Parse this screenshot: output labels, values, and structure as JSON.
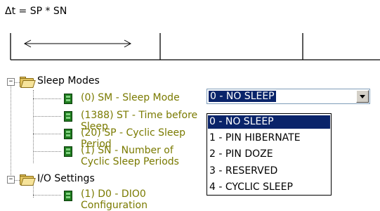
{
  "formula": "Δt = SP * SN",
  "tree": {
    "groups": [
      {
        "label": "Sleep Modes",
        "expander": "−",
        "params": [
          {
            "label": "(0) SM - Sleep Mode"
          },
          {
            "label": "(1388) ST - Time before Sleep"
          },
          {
            "label": "(20) SP - Cyclic Sleep Period"
          },
          {
            "label": "(1) SN - Number of Cyclic Sleep Periods"
          }
        ]
      },
      {
        "label": "I/O Settings",
        "expander": "−",
        "params": [
          {
            "label": "(1) D0 - DIO0 Configuration"
          }
        ]
      }
    ]
  },
  "combo": {
    "value": "0 - NO SLEEP",
    "options": [
      "0 - NO SLEEP",
      "1 - PIN HIBERNATE",
      "2 - PIN DOZE",
      "3 - RESERVED",
      "4 - CYCLIC SLEEP"
    ],
    "selected_index": 0
  },
  "colors": {
    "selection": "#0a246a",
    "param_text": "#7a7a00",
    "folder": "#e2c35f",
    "param_icon": "#1f7a1f"
  }
}
